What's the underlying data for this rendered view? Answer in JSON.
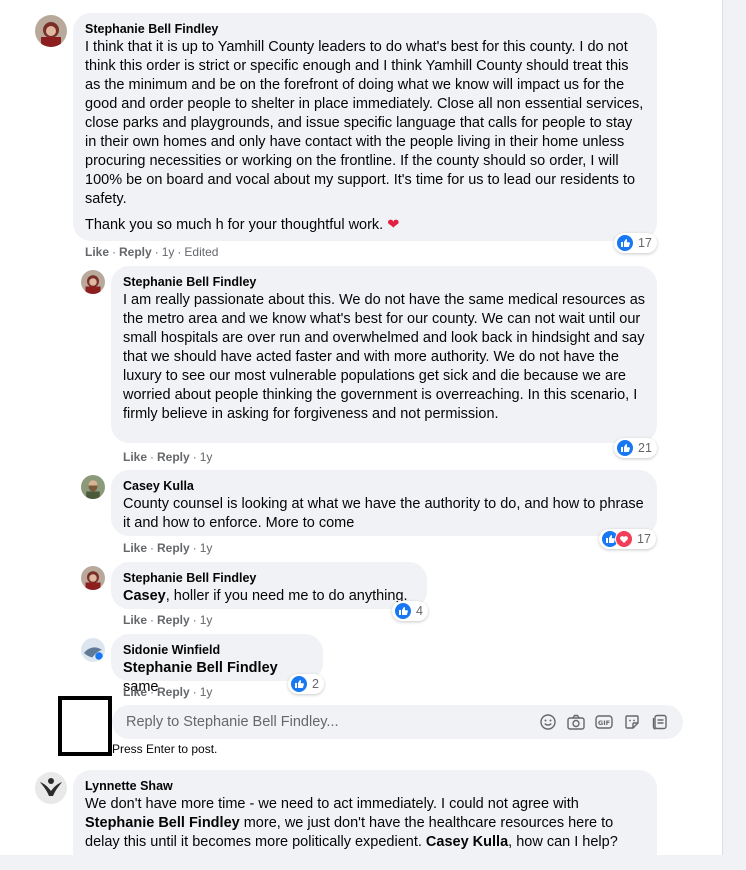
{
  "colors": {
    "like_blue": "#1877f2",
    "love_red": "#f33e58",
    "bubble_bg": "#f0f2f5",
    "meta_gray": "#65676b"
  },
  "actions": {
    "like": "Like",
    "reply": "Reply",
    "separator": "·"
  },
  "comments": [
    {
      "author": "Stephanie Bell Findley",
      "text": "I think that it is up to Yamhill County leaders to do what's best for this county. I do not think this order is strict or specific enough and I think Yamhill County should treat this as the minimum and be on the forefront of doing what we know will impact us for the good and order people to shelter in place immediately. Close all non essential services, close parks and playgrounds, and issue specific language that calls for people to stay in their own homes and only have contact with the people living in their home unless procuring necessities or working on the frontline. If the county should so order, I will 100% be on board and vocal about my support. It's time for us to lead our residents to safety.",
      "text2": "Thank you so much h for your thoughtful work.",
      "emoji": "heart-emoji",
      "time": "1y",
      "edited": "Edited",
      "reactions": "17",
      "avatar_icon": "user-avatar-icon"
    }
  ],
  "replies": [
    {
      "author": "Stephanie Bell Findley",
      "text": "I am really passionate about this. We do not have the same medical resources as the metro area and we know what's best for our county. We can not wait until our small hospitals are over run and overwhelmed and look back in hindsight and say that we should have acted faster and with more authority. We do not have the luxury to see our most vulnerable populations get sick and die because we are worried about people thinking the government is overreaching. In this scenario, I firmly believe in asking for forgiveness and not permission.",
      "time": "1y",
      "reactions": "21"
    },
    {
      "author": "Casey Kulla",
      "text": "County counsel is looking at what we have the authority to do, and how to phrase it and how to enforce. More to come",
      "time": "1y",
      "reactions": "17"
    },
    {
      "author": "Stephanie Bell Findley",
      "mention": "Casey",
      "text": ", holler if you need me to do anything.",
      "time": "1y",
      "reactions": "4"
    },
    {
      "author": "Sidonie Winfield",
      "mention": "Stephanie Bell Findley",
      "text": " same",
      "time": "1y",
      "reactions": "2"
    }
  ],
  "reply_input": {
    "placeholder": "Reply to Stephanie Bell Findley...",
    "hint": "Press Enter to post.",
    "tools": [
      "emoji-icon",
      "camera-icon",
      "gif-icon",
      "sticker-icon",
      "more-stickers-icon"
    ]
  },
  "next_comment": {
    "author": "Lynnette Shaw",
    "text_a": "We don't have more time - we need to act immediately. I could not agree with ",
    "mention_a": "Stephanie Bell Findley",
    "text_b": " more, we just don't have the healthcare resources here to delay this until it becomes more politically expedient. ",
    "mention_b": "Casey Kulla",
    "text_c": ", how can I help?"
  }
}
